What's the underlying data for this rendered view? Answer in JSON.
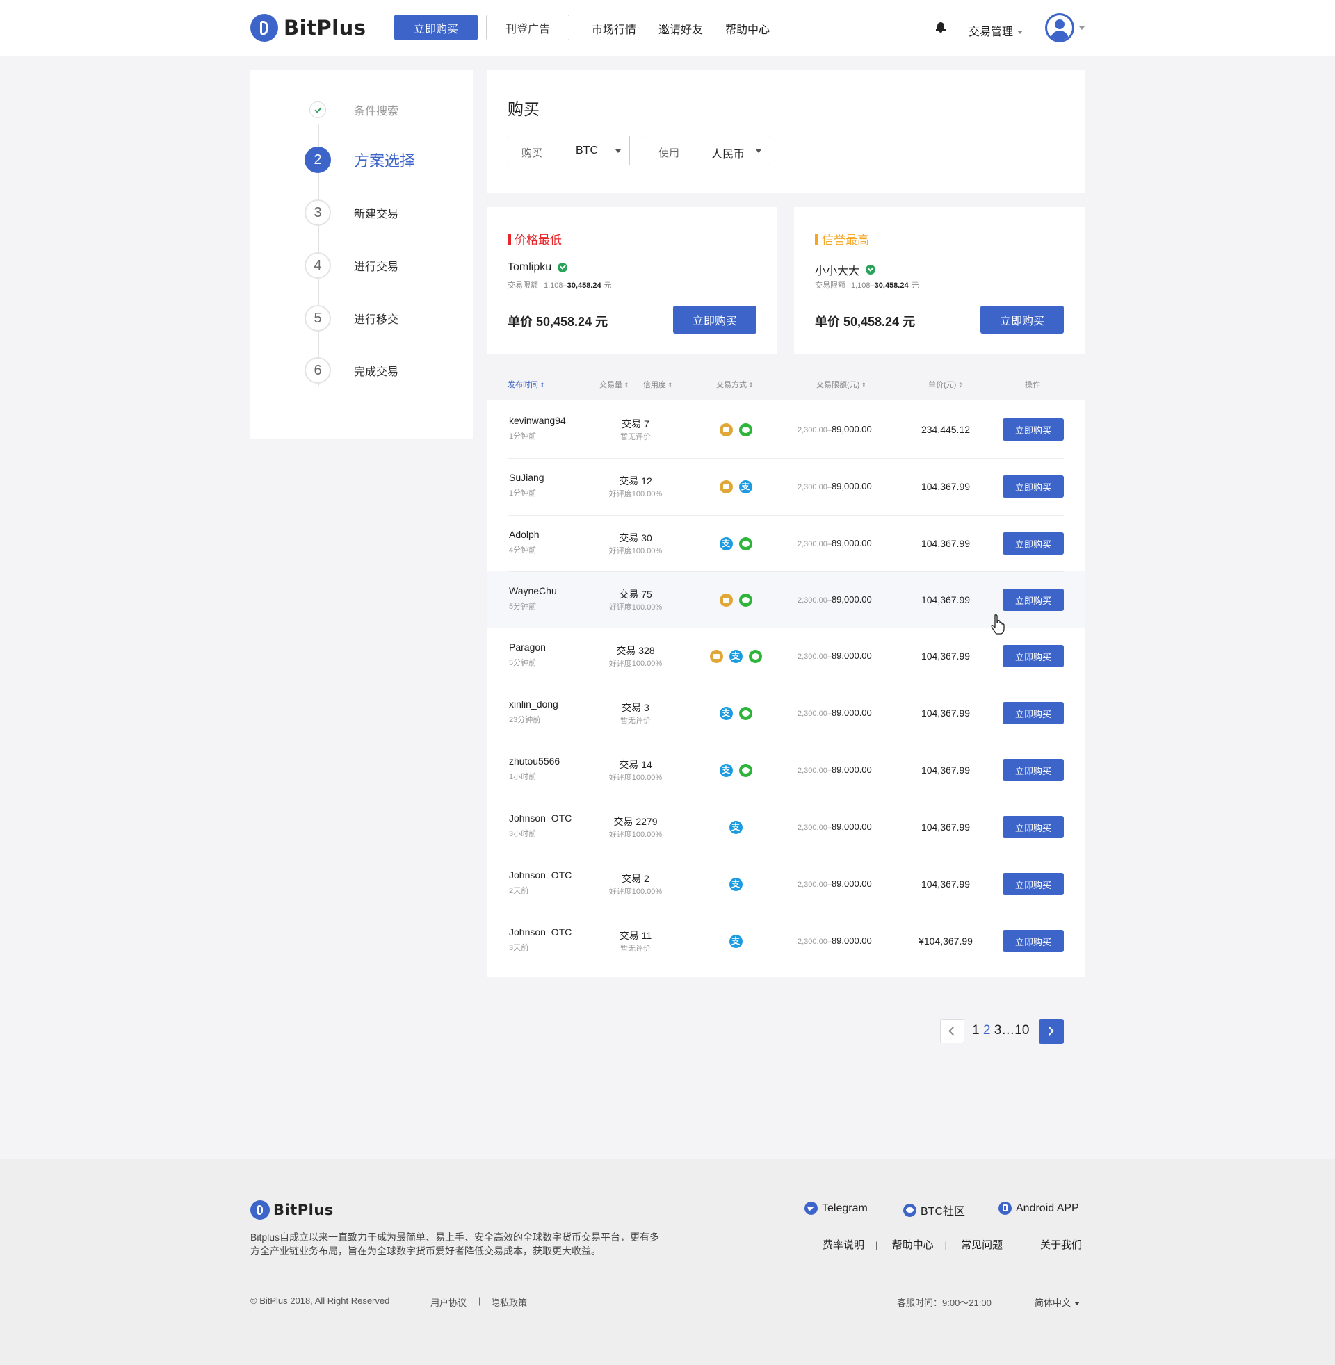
{
  "header": {
    "logo_text": "BitPlus",
    "buy_now": "立即购买",
    "post_ad": "刊登广告",
    "nav": [
      "市场行情",
      "邀请好友",
      "帮助中心"
    ],
    "trade_mgmt": "交易管理"
  },
  "steps": [
    {
      "label": "条件搜索",
      "state": "done"
    },
    {
      "num": "2",
      "label": "方案选择",
      "state": "active"
    },
    {
      "num": "3",
      "label": "新建交易",
      "state": "todo"
    },
    {
      "num": "4",
      "label": "进行交易",
      "state": "todo"
    },
    {
      "num": "5",
      "label": "进行移交",
      "state": "todo"
    },
    {
      "num": "6",
      "label": "完成交易",
      "state": "todo"
    }
  ],
  "buy_panel": {
    "title": "购买",
    "coin_label": "购买",
    "coin_value": "BTC",
    "currency_label": "使用",
    "currency_value": "人民币"
  },
  "best_cards": [
    {
      "tag": "价格最低",
      "tag_color": "#e8262a",
      "name": "Tomlipku",
      "limit_label": "交易限额",
      "limit_min": "1,108–",
      "limit_max": "30,458.24",
      "limit_unit": "元",
      "price": "单价 50,458.24 元",
      "button": "立即购买"
    },
    {
      "tag": "信誉最高",
      "tag_color": "#f5a623",
      "name": "小小大大",
      "limit_label": "交易限额",
      "limit_min": "1,108–",
      "limit_max": "30,458.24",
      "limit_unit": "元",
      "price": "单价 50,458.24 元",
      "button": "立即购买"
    }
  ],
  "columns": {
    "publish_time": "发布时间",
    "volume": "交易量",
    "credit": "信用度",
    "method": "交易方式",
    "limit": "交易限额(元)",
    "unit_price": "单价(元)",
    "action": "操作"
  },
  "rows": [
    {
      "user": "kevinwang94",
      "time": "1分钟前",
      "trades": "交易 7",
      "rating": "暂无评价",
      "pays": [
        "bank",
        "wechat"
      ],
      "limit_min": "2,300.00–",
      "limit_max": "89,000.00",
      "price": "234,445.12",
      "button": "立即购买"
    },
    {
      "user": "SuJiang",
      "time": "1分钟前",
      "trades": "交易 12",
      "rating": "好评度100.00%",
      "pays": [
        "bank",
        "alipay"
      ],
      "limit_min": "2,300.00–",
      "limit_max": "89,000.00",
      "price": "104,367.99",
      "button": "立即购买"
    },
    {
      "user": "Adolph",
      "time": "4分钟前",
      "trades": "交易 30",
      "rating": "好评度100.00%",
      "pays": [
        "alipay",
        "wechat"
      ],
      "limit_min": "2,300.00–",
      "limit_max": "89,000.00",
      "price": "104,367.99",
      "button": "立即购买"
    },
    {
      "user": "WayneChu",
      "time": "5分钟前",
      "trades": "交易 75",
      "rating": "好评度100.00%",
      "pays": [
        "bank",
        "wechat"
      ],
      "limit_min": "2,300.00–",
      "limit_max": "89,000.00",
      "price": "104,367.99",
      "button": "立即购买"
    },
    {
      "user": "Paragon",
      "time": "5分钟前",
      "trades": "交易 328",
      "rating": "好评度100.00%",
      "pays": [
        "bank",
        "alipay",
        "wechat"
      ],
      "limit_min": "2,300.00–",
      "limit_max": "89,000.00",
      "price": "104,367.99",
      "button": "立即购买"
    },
    {
      "user": "xinlin_dong",
      "time": "23分钟前",
      "trades": "交易 3",
      "rating": "暂无评价",
      "pays": [
        "alipay",
        "wechat"
      ],
      "limit_min": "2,300.00–",
      "limit_max": "89,000.00",
      "price": "104,367.99",
      "button": "立即购买"
    },
    {
      "user": "zhutou5566",
      "time": "1小时前",
      "trades": "交易 14",
      "rating": "好评度100.00%",
      "pays": [
        "alipay",
        "wechat"
      ],
      "limit_min": "2,300.00–",
      "limit_max": "89,000.00",
      "price": "104,367.99",
      "button": "立即购买"
    },
    {
      "user": "Johnson–OTC",
      "time": "3小时前",
      "trades": "交易 2279",
      "rating": "好评度100.00%",
      "pays": [
        "alipay"
      ],
      "limit_min": "2,300.00–",
      "limit_max": "89,000.00",
      "price": "104,367.99",
      "button": "立即购买"
    },
    {
      "user": "Johnson–OTC",
      "time": "2天前",
      "trades": "交易 2",
      "rating": "好评度100.00%",
      "pays": [
        "alipay"
      ],
      "limit_min": "2,300.00–",
      "limit_max": "89,000.00",
      "price": "104,367.99",
      "button": "立即购买"
    },
    {
      "user": "Johnson–OTC",
      "time": "3天前",
      "trades": "交易 11",
      "rating": "暂无评价",
      "pays": [
        "alipay"
      ],
      "limit_min": "2,300.00–",
      "limit_max": "89,000.00",
      "price": "¥104,367.99",
      "button": "立即购买"
    }
  ],
  "pagination": {
    "p1": "1",
    "current": "2",
    "rest": "3…10"
  },
  "footer": {
    "logo_text": "BitPlus",
    "desc": "Bitplus自成立以来一直致力于成为最简单、易上手、安全高效的全球数字货币交易平台，更有多方全产业链业务布局，旨在为全球数字货币爱好者降低交易成本，获取更大收益。",
    "social": [
      "Telegram",
      "BTC社区",
      "Android APP"
    ],
    "links": [
      "费率说明",
      "帮助中心",
      "常见问题",
      "关于我们"
    ],
    "copyright": "© BitPlus 2018, All Right Reserved",
    "user_agreement": "用户协议",
    "privacy": "隐私政策",
    "service_hours": "客服时间：9:00～21:00",
    "language": "简体中文"
  },
  "colors": {
    "accent": "#3d64c8",
    "success": "#2aa35a",
    "alipay": "#1d9be1",
    "wechat": "#2db53a",
    "bank": "#e0a636"
  },
  "icons": {
    "pay_bank": "bank-card-icon",
    "pay_alipay": "alipay-icon",
    "pay_wechat": "wechat-pay-icon"
  }
}
